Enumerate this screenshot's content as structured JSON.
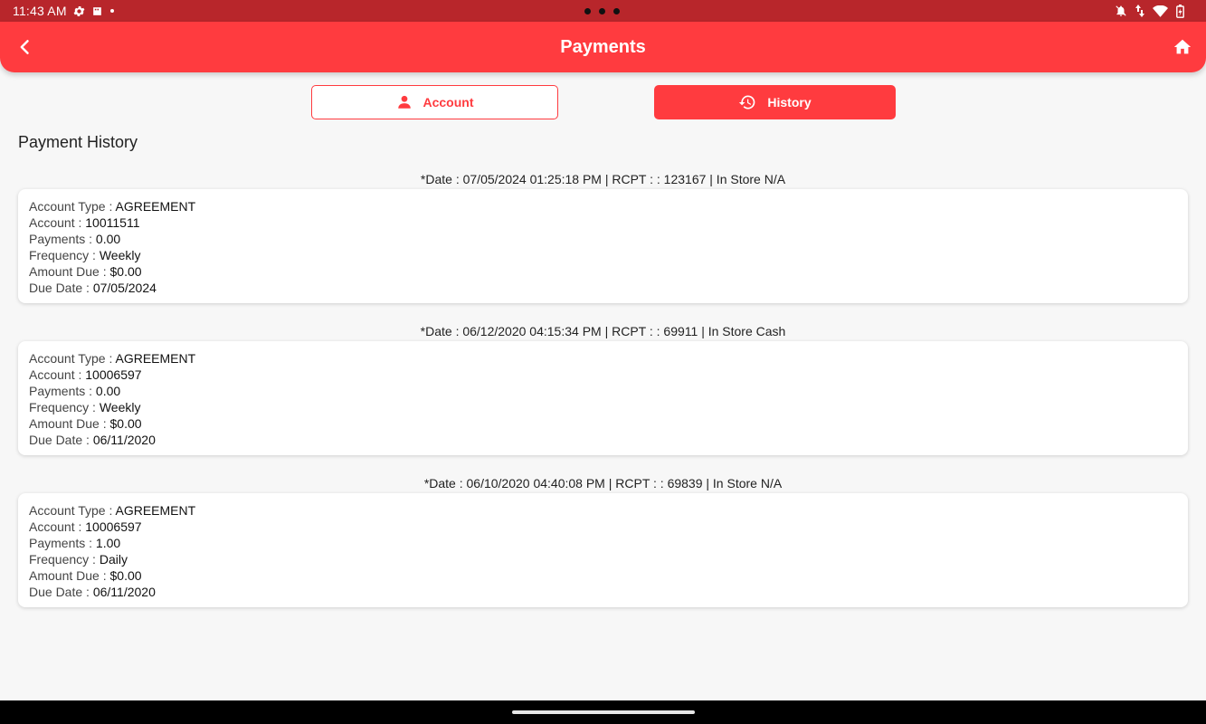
{
  "status_bar": {
    "time": "11:43 AM"
  },
  "header": {
    "title": "Payments"
  },
  "tabs": {
    "account_label": "Account",
    "history_label": "History"
  },
  "section_title": "Payment History",
  "records": [
    {
      "header": "*Date : 07/05/2024 01:25:18 PM | RCPT : : 123167 | In Store N/A",
      "fields": [
        {
          "label": "Account Type : ",
          "value": "AGREEMENT"
        },
        {
          "label": "Account : ",
          "value": "10011511"
        },
        {
          "label": "Payments : ",
          "value": "0.00"
        },
        {
          "label": "Frequency : ",
          "value": "Weekly"
        },
        {
          "label": "Amount Due : ",
          "value": "$0.00"
        },
        {
          "label": "Due Date : ",
          "value": "07/05/2024"
        }
      ]
    },
    {
      "header": "*Date : 06/12/2020 04:15:34 PM | RCPT : : 69911 | In Store Cash",
      "fields": [
        {
          "label": "Account Type : ",
          "value": "AGREEMENT"
        },
        {
          "label": "Account : ",
          "value": "10006597"
        },
        {
          "label": "Payments : ",
          "value": "0.00"
        },
        {
          "label": "Frequency : ",
          "value": "Weekly"
        },
        {
          "label": "Amount Due : ",
          "value": "$0.00"
        },
        {
          "label": "Due Date : ",
          "value": "06/11/2020"
        }
      ]
    },
    {
      "header": "*Date : 06/10/2020 04:40:08 PM | RCPT : : 69839 | In Store N/A",
      "fields": [
        {
          "label": "Account Type : ",
          "value": "AGREEMENT"
        },
        {
          "label": "Account : ",
          "value": "10006597"
        },
        {
          "label": "Payments : ",
          "value": "1.00"
        },
        {
          "label": "Frequency : ",
          "value": "Daily"
        },
        {
          "label": "Amount Due : ",
          "value": "$0.00"
        },
        {
          "label": "Due Date : ",
          "value": "06/11/2020"
        }
      ]
    }
  ],
  "colors": {
    "primary": "#ff3b3f",
    "status_bar": "#b8262b"
  },
  "icons": {
    "back": "chevron-left-icon",
    "home": "home-icon",
    "account": "person-icon",
    "history": "history-icon"
  }
}
